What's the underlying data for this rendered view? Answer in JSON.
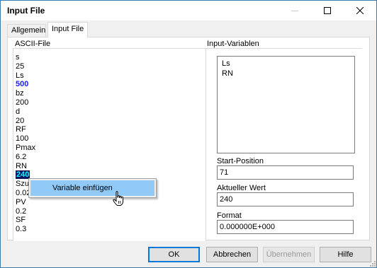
{
  "window": {
    "title": "Input File"
  },
  "tabs": [
    {
      "label": "Allgemein"
    },
    {
      "label": "Input File"
    }
  ],
  "ascii": {
    "label": "ASCII-File",
    "lines": [
      {
        "text": "s",
        "style": "normal"
      },
      {
        "text": "25",
        "style": "normal"
      },
      {
        "text": "Ls",
        "style": "normal"
      },
      {
        "text": "500",
        "style": "num"
      },
      {
        "text": "bz",
        "style": "normal"
      },
      {
        "text": "200",
        "style": "normal"
      },
      {
        "text": "d",
        "style": "normal"
      },
      {
        "text": "20",
        "style": "normal"
      },
      {
        "text": "RF",
        "style": "normal"
      },
      {
        "text": "100",
        "style": "normal"
      },
      {
        "text": "Pmax",
        "style": "normal"
      },
      {
        "text": "6.2",
        "style": "normal"
      },
      {
        "text": "RN",
        "style": "normal"
      },
      {
        "text": "240",
        "style": "sel"
      },
      {
        "text": "Szu",
        "style": "normal"
      },
      {
        "text": "0.02",
        "style": "normal"
      },
      {
        "text": "PV",
        "style": "normal"
      },
      {
        "text": "0.2",
        "style": "normal"
      },
      {
        "text": "SF",
        "style": "normal"
      },
      {
        "text": "0.3",
        "style": "normal"
      }
    ]
  },
  "vars": {
    "label": "Input-Variablen",
    "items": [
      "Ls",
      "RN"
    ]
  },
  "fields": {
    "start_label": "Start-Position",
    "start_value": "71",
    "current_label": "Aktueller Wert",
    "current_value": "240",
    "format_label": "Format",
    "format_value": "0.000000E+000"
  },
  "context_menu": {
    "item": "Variable einfügen"
  },
  "buttons": {
    "ok": "OK",
    "cancel": "Abbrechen",
    "apply": "Übernehmen",
    "help": "Hilfe"
  },
  "colors": {
    "accent": "#0078d7",
    "menu_highlight": "#91c9f7",
    "selection_bg": "#101060",
    "selection_fg": "#00ffff",
    "number": "#1a1aff"
  }
}
